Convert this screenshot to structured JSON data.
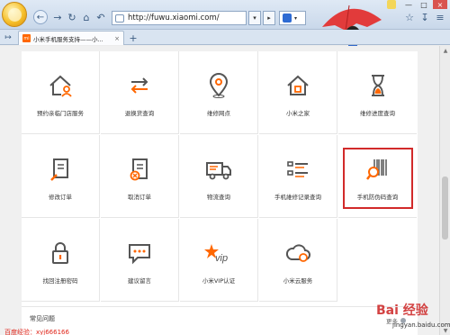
{
  "browser": {
    "url": "http://fuwu.xiaomi.com/",
    "tab_title": "小米手机服务支持——小...",
    "tab_favicon_text": "mi",
    "new_tab_symbol": "+",
    "tab_close_symbol": "×",
    "dropdown_symbol": "▾",
    "nav_icons": [
      "back-icon",
      "forward-icon",
      "refresh-icon",
      "home-icon",
      "undo-icon"
    ],
    "accent_color": "#ff6700",
    "highlight_color": "#d22a2a"
  },
  "services": [
    {
      "label": "预约亲临门店服务",
      "icon": "house-person-icon"
    },
    {
      "label": "退换货查询",
      "icon": "exchange-arrows-icon"
    },
    {
      "label": "维修网点",
      "icon": "location-pin-icon"
    },
    {
      "label": "小米之家",
      "icon": "home-mi-icon"
    },
    {
      "label": "维修进度查询",
      "icon": "hourglass-icon"
    },
    {
      "label": "修改订单",
      "icon": "edit-order-icon"
    },
    {
      "label": "取消订单",
      "icon": "cancel-order-icon"
    },
    {
      "label": "物流查询",
      "icon": "delivery-truck-icon"
    },
    {
      "label": "手机維修记录查询",
      "icon": "repair-record-icon"
    },
    {
      "label": "手机防伪码查询",
      "icon": "barcode-search-icon"
    },
    {
      "label": "找回注册密码",
      "icon": "padlock-icon"
    },
    {
      "label": "建议留言",
      "icon": "chat-bubble-icon"
    },
    {
      "label": "小米VIP认证",
      "icon": "vip-star-icon"
    },
    {
      "label": "小米云服务",
      "icon": "cloud-icon"
    }
  ],
  "faq": {
    "title": "常见问题",
    "more_label": "更多"
  },
  "footer_note": "百度经验：xyj666166",
  "watermark": {
    "brand": "Bai 经验",
    "domain": "jingyan.baidu.com"
  }
}
